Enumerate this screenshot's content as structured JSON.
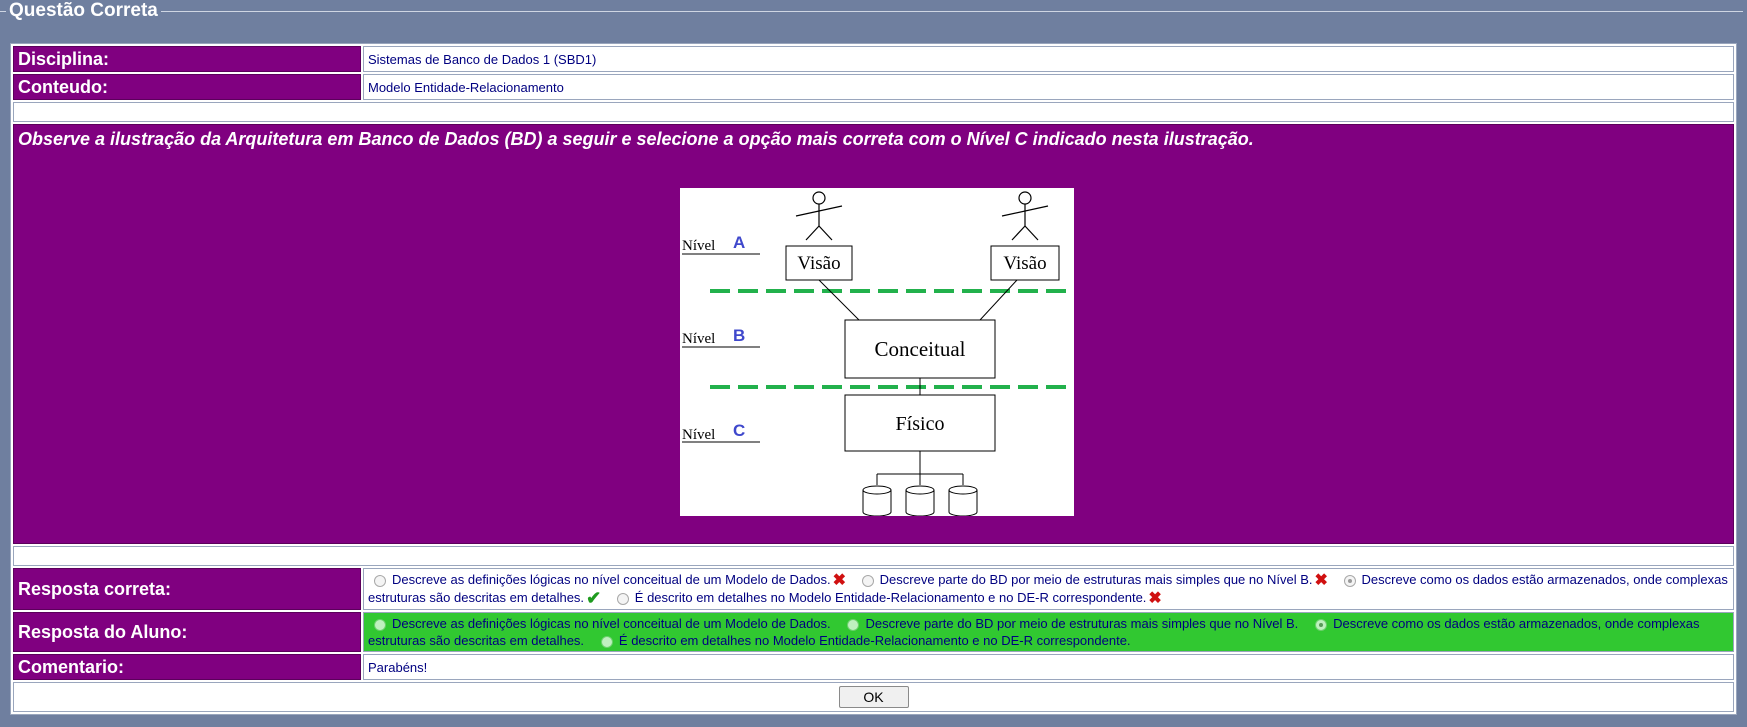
{
  "window": {
    "legend": "Questão Correta"
  },
  "fields": {
    "disciplina_label": "Disciplina:",
    "disciplina_value": "Sistemas de Banco de Dados 1 (SBD1)",
    "conteudo_label": "Conteudo:",
    "conteudo_value": "Modelo Entidade-Relacionamento"
  },
  "question": {
    "text": "Observe a ilustração da Arquitetura em Banco de Dados (BD) a seguir e selecione a opção mais correta com o Nível C indicado nesta ilustração.",
    "diagram": {
      "level_word": "Nível",
      "levels": [
        "A",
        "B",
        "C"
      ],
      "boxes": {
        "view": "Visão",
        "conceptual": "Conceitual",
        "physical": "Físico"
      }
    }
  },
  "answers": {
    "correct_label": "Resposta correta:",
    "student_label": "Resposta do Aluno:",
    "options": [
      "Descreve as definições lógicas no nível conceitual de um Modelo de Dados.",
      "Descreve parte do BD por meio de estruturas mais simples que no Nível B.",
      "Descreve como os dados estão armazenados, onde complexas estruturas são descritas em detalhes.",
      "É descrito em detalhes no Modelo Entidade-Relacionamento e no DE-R correspondente."
    ],
    "correct_index": 2,
    "student_index": 2
  },
  "comment": {
    "label": "Comentario:",
    "value": "Parabéns!"
  },
  "ok_button": "OK",
  "colors": {
    "purple": "#800080",
    "green_row": "#31c831",
    "text_blue": "#000080",
    "dash_green": "#22b14c",
    "level_blue": "#3f48cc"
  }
}
